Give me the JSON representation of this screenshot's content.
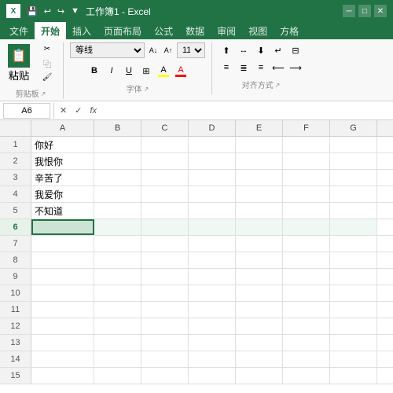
{
  "titleBar": {
    "title": "工作簿1 - Excel",
    "icon": "X"
  },
  "ribbonTabs": {
    "tabs": [
      "文件",
      "开始",
      "插入",
      "页面布局",
      "公式",
      "数据",
      "审阅",
      "视图",
      "方格"
    ]
  },
  "ribbon": {
    "clipboard": {
      "label": "剪贴板",
      "paste": "粘贴",
      "cut": "✂",
      "copy": "⿻",
      "format": "⚡"
    },
    "font": {
      "label": "字体",
      "fontName": "等线",
      "fontSize": "11",
      "bold": "B",
      "italic": "I",
      "underline": "U",
      "border": "⊞",
      "fillColor": "A",
      "fontColor": "A"
    },
    "alignment": {
      "label": "对齐方式"
    }
  },
  "formulaBar": {
    "nameBox": "A6",
    "cancelBtn": "✕",
    "confirmBtn": "✓",
    "functionBtn": "fx"
  },
  "columns": [
    "A",
    "B",
    "C",
    "D",
    "E",
    "F",
    "G"
  ],
  "rows": [
    {
      "num": 1,
      "a": "你好",
      "b": "",
      "c": "",
      "d": "",
      "e": "",
      "f": "",
      "g": ""
    },
    {
      "num": 2,
      "a": "我恨你",
      "b": "",
      "c": "",
      "d": "",
      "e": "",
      "f": "",
      "g": ""
    },
    {
      "num": 3,
      "a": "辛苦了",
      "b": "",
      "c": "",
      "d": "",
      "e": "",
      "f": "",
      "g": ""
    },
    {
      "num": 4,
      "a": "我爱你",
      "b": "",
      "c": "",
      "d": "",
      "e": "",
      "f": "",
      "g": ""
    },
    {
      "num": 5,
      "a": "不知道",
      "b": "",
      "c": "",
      "d": "",
      "e": "",
      "f": "",
      "g": ""
    },
    {
      "num": 6,
      "a": "",
      "b": "",
      "c": "",
      "d": "",
      "e": "",
      "f": "",
      "g": ""
    },
    {
      "num": 7,
      "a": "",
      "b": "",
      "c": "",
      "d": "",
      "e": "",
      "f": "",
      "g": ""
    },
    {
      "num": 8,
      "a": "",
      "b": "",
      "c": "",
      "d": "",
      "e": "",
      "f": "",
      "g": ""
    },
    {
      "num": 9,
      "a": "",
      "b": "",
      "c": "",
      "d": "",
      "e": "",
      "f": "",
      "g": ""
    },
    {
      "num": 10,
      "a": "",
      "b": "",
      "c": "",
      "d": "",
      "e": "",
      "f": "",
      "g": ""
    },
    {
      "num": 11,
      "a": "",
      "b": "",
      "c": "",
      "d": "",
      "e": "",
      "f": "",
      "g": ""
    },
    {
      "num": 12,
      "a": "",
      "b": "",
      "c": "",
      "d": "",
      "e": "",
      "f": "",
      "g": ""
    },
    {
      "num": 13,
      "a": "",
      "b": "",
      "c": "",
      "d": "",
      "e": "",
      "f": "",
      "g": ""
    },
    {
      "num": 14,
      "a": "",
      "b": "",
      "c": "",
      "d": "",
      "e": "",
      "f": "",
      "g": ""
    },
    {
      "num": 15,
      "a": "",
      "b": "",
      "c": "",
      "d": "",
      "e": "",
      "f": "",
      "g": ""
    }
  ]
}
